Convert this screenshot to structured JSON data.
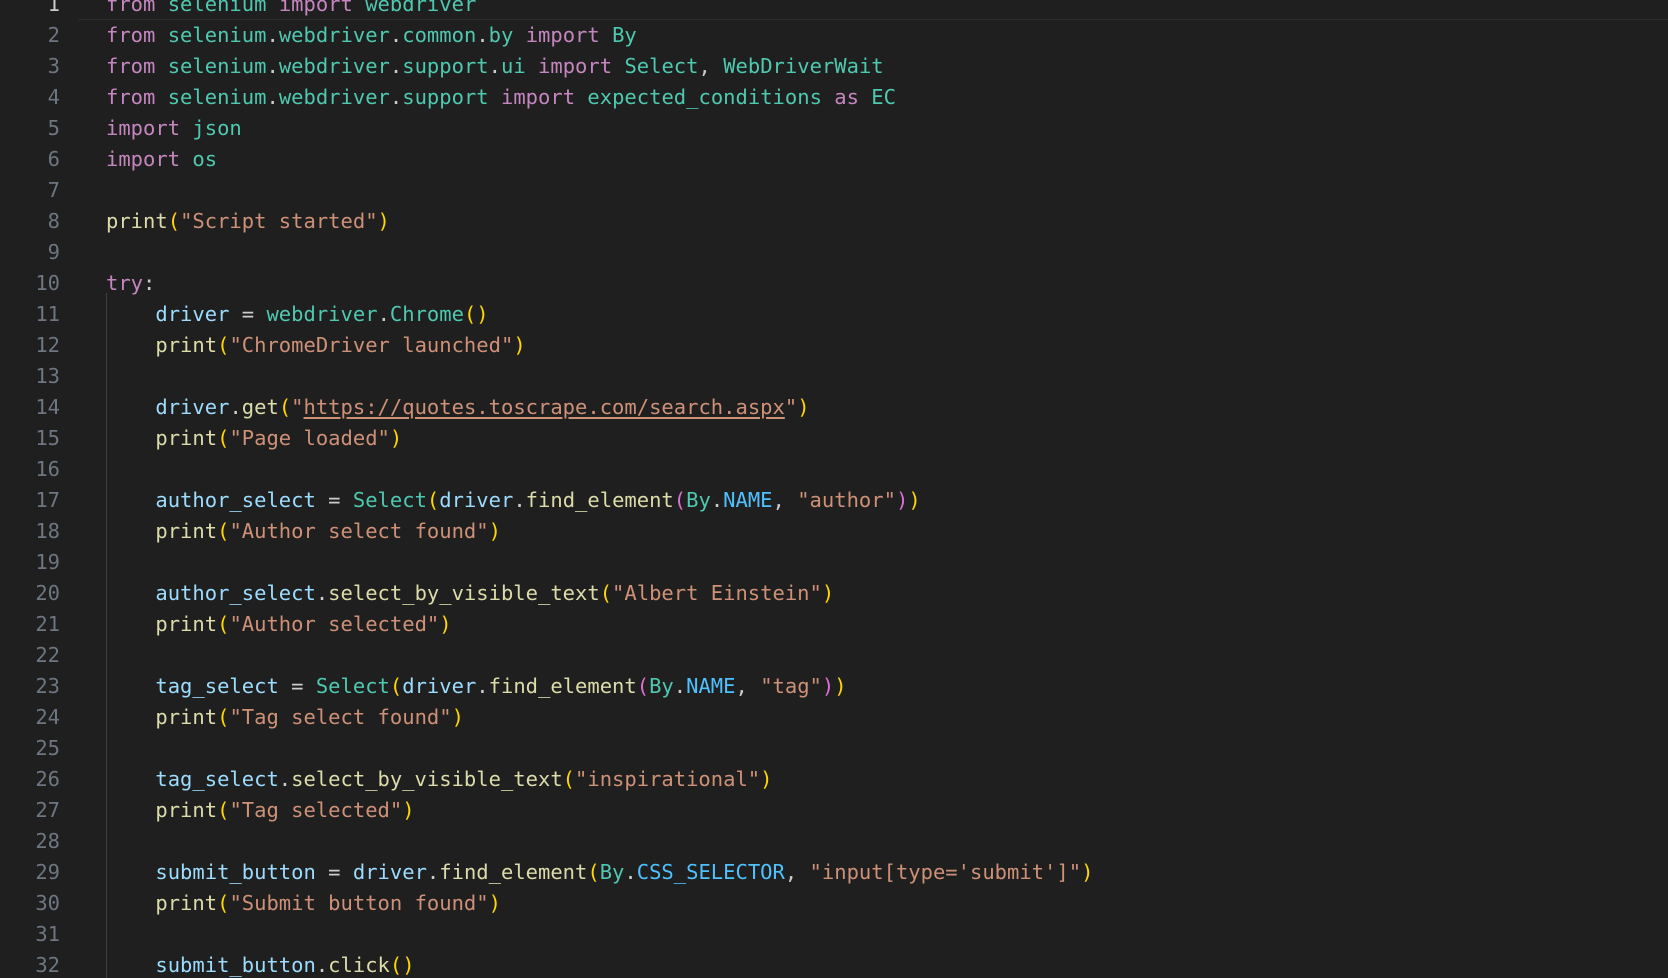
{
  "editor": {
    "language": "python",
    "active_line": 1,
    "colors": {
      "background": "#1f1f1f",
      "line_number": "#6e7681",
      "keyword": "#c586c0",
      "module_class": "#4ec9b0",
      "function": "#dcdcaa",
      "variable": "#9cdcfe",
      "constant": "#4fc1ff",
      "string": "#ce9178",
      "bracket_level_1": "#ffd700",
      "bracket_level_2": "#da70d6"
    },
    "lines": [
      {
        "n": "1",
        "tokens": [
          [
            "kw",
            "from"
          ],
          [
            "plain",
            " "
          ],
          [
            "mod",
            "selenium"
          ],
          [
            "plain",
            " "
          ],
          [
            "kw",
            "import"
          ],
          [
            "plain",
            " "
          ],
          [
            "mod",
            "webdriver"
          ]
        ]
      },
      {
        "n": "2",
        "tokens": [
          [
            "kw",
            "from"
          ],
          [
            "plain",
            " "
          ],
          [
            "mod",
            "selenium"
          ],
          [
            "plain",
            "."
          ],
          [
            "mod",
            "webdriver"
          ],
          [
            "plain",
            "."
          ],
          [
            "mod",
            "common"
          ],
          [
            "plain",
            "."
          ],
          [
            "mod",
            "by"
          ],
          [
            "plain",
            " "
          ],
          [
            "kw",
            "import"
          ],
          [
            "plain",
            " "
          ],
          [
            "cls",
            "By"
          ]
        ]
      },
      {
        "n": "3",
        "tokens": [
          [
            "kw",
            "from"
          ],
          [
            "plain",
            " "
          ],
          [
            "mod",
            "selenium"
          ],
          [
            "plain",
            "."
          ],
          [
            "mod",
            "webdriver"
          ],
          [
            "plain",
            "."
          ],
          [
            "mod",
            "support"
          ],
          [
            "plain",
            "."
          ],
          [
            "mod",
            "ui"
          ],
          [
            "plain",
            " "
          ],
          [
            "kw",
            "import"
          ],
          [
            "plain",
            " "
          ],
          [
            "cls",
            "Select"
          ],
          [
            "plain",
            ", "
          ],
          [
            "cls",
            "WebDriverWait"
          ]
        ]
      },
      {
        "n": "4",
        "tokens": [
          [
            "kw",
            "from"
          ],
          [
            "plain",
            " "
          ],
          [
            "mod",
            "selenium"
          ],
          [
            "plain",
            "."
          ],
          [
            "mod",
            "webdriver"
          ],
          [
            "plain",
            "."
          ],
          [
            "mod",
            "support"
          ],
          [
            "plain",
            " "
          ],
          [
            "kw",
            "import"
          ],
          [
            "plain",
            " "
          ],
          [
            "mod",
            "expected_conditions"
          ],
          [
            "plain",
            " "
          ],
          [
            "kw",
            "as"
          ],
          [
            "plain",
            " "
          ],
          [
            "mod",
            "EC"
          ]
        ]
      },
      {
        "n": "5",
        "tokens": [
          [
            "kw",
            "import"
          ],
          [
            "plain",
            " "
          ],
          [
            "mod",
            "json"
          ]
        ]
      },
      {
        "n": "6",
        "tokens": [
          [
            "kw",
            "import"
          ],
          [
            "plain",
            " "
          ],
          [
            "mod",
            "os"
          ]
        ]
      },
      {
        "n": "7",
        "tokens": []
      },
      {
        "n": "8",
        "tokens": [
          [
            "fn",
            "print"
          ],
          [
            "p1",
            "("
          ],
          [
            "str",
            "\"Script started\""
          ],
          [
            "p1",
            ")"
          ]
        ]
      },
      {
        "n": "9",
        "tokens": []
      },
      {
        "n": "10",
        "tokens": [
          [
            "kw",
            "try"
          ],
          [
            "plain",
            ":"
          ]
        ]
      },
      {
        "n": "11",
        "tokens": [
          [
            "plain",
            "    "
          ],
          [
            "var",
            "driver"
          ],
          [
            "plain",
            " = "
          ],
          [
            "mod",
            "webdriver"
          ],
          [
            "plain",
            "."
          ],
          [
            "cls",
            "Chrome"
          ],
          [
            "p1",
            "()"
          ]
        ]
      },
      {
        "n": "12",
        "tokens": [
          [
            "plain",
            "    "
          ],
          [
            "fn",
            "print"
          ],
          [
            "p1",
            "("
          ],
          [
            "str",
            "\"ChromeDriver launched\""
          ],
          [
            "p1",
            ")"
          ]
        ]
      },
      {
        "n": "13",
        "tokens": []
      },
      {
        "n": "14",
        "tokens": [
          [
            "plain",
            "    "
          ],
          [
            "var",
            "driver"
          ],
          [
            "plain",
            "."
          ],
          [
            "fn",
            "get"
          ],
          [
            "p1",
            "("
          ],
          [
            "str",
            "\""
          ],
          [
            "str url",
            "https://quotes.toscrape.com/search.aspx"
          ],
          [
            "str",
            "\""
          ],
          [
            "p1",
            ")"
          ]
        ]
      },
      {
        "n": "15",
        "tokens": [
          [
            "plain",
            "    "
          ],
          [
            "fn",
            "print"
          ],
          [
            "p1",
            "("
          ],
          [
            "str",
            "\"Page loaded\""
          ],
          [
            "p1",
            ")"
          ]
        ]
      },
      {
        "n": "16",
        "tokens": []
      },
      {
        "n": "17",
        "tokens": [
          [
            "plain",
            "    "
          ],
          [
            "var",
            "author_select"
          ],
          [
            "plain",
            " = "
          ],
          [
            "cls",
            "Select"
          ],
          [
            "p1",
            "("
          ],
          [
            "var",
            "driver"
          ],
          [
            "plain",
            "."
          ],
          [
            "fn",
            "find_element"
          ],
          [
            "p2",
            "("
          ],
          [
            "cls",
            "By"
          ],
          [
            "plain",
            "."
          ],
          [
            "const",
            "NAME"
          ],
          [
            "plain",
            ", "
          ],
          [
            "str",
            "\"author\""
          ],
          [
            "p2",
            ")"
          ],
          [
            "p1",
            ")"
          ]
        ]
      },
      {
        "n": "18",
        "tokens": [
          [
            "plain",
            "    "
          ],
          [
            "fn",
            "print"
          ],
          [
            "p1",
            "("
          ],
          [
            "str",
            "\"Author select found\""
          ],
          [
            "p1",
            ")"
          ]
        ]
      },
      {
        "n": "19",
        "tokens": []
      },
      {
        "n": "20",
        "tokens": [
          [
            "plain",
            "    "
          ],
          [
            "var",
            "author_select"
          ],
          [
            "plain",
            "."
          ],
          [
            "fn",
            "select_by_visible_text"
          ],
          [
            "p1",
            "("
          ],
          [
            "str",
            "\"Albert Einstein\""
          ],
          [
            "p1",
            ")"
          ]
        ]
      },
      {
        "n": "21",
        "tokens": [
          [
            "plain",
            "    "
          ],
          [
            "fn",
            "print"
          ],
          [
            "p1",
            "("
          ],
          [
            "str",
            "\"Author selected\""
          ],
          [
            "p1",
            ")"
          ]
        ]
      },
      {
        "n": "22",
        "tokens": []
      },
      {
        "n": "23",
        "tokens": [
          [
            "plain",
            "    "
          ],
          [
            "var",
            "tag_select"
          ],
          [
            "plain",
            " = "
          ],
          [
            "cls",
            "Select"
          ],
          [
            "p1",
            "("
          ],
          [
            "var",
            "driver"
          ],
          [
            "plain",
            "."
          ],
          [
            "fn",
            "find_element"
          ],
          [
            "p2",
            "("
          ],
          [
            "cls",
            "By"
          ],
          [
            "plain",
            "."
          ],
          [
            "const",
            "NAME"
          ],
          [
            "plain",
            ", "
          ],
          [
            "str",
            "\"tag\""
          ],
          [
            "p2",
            ")"
          ],
          [
            "p1",
            ")"
          ]
        ]
      },
      {
        "n": "24",
        "tokens": [
          [
            "plain",
            "    "
          ],
          [
            "fn",
            "print"
          ],
          [
            "p1",
            "("
          ],
          [
            "str",
            "\"Tag select found\""
          ],
          [
            "p1",
            ")"
          ]
        ]
      },
      {
        "n": "25",
        "tokens": []
      },
      {
        "n": "26",
        "tokens": [
          [
            "plain",
            "    "
          ],
          [
            "var",
            "tag_select"
          ],
          [
            "plain",
            "."
          ],
          [
            "fn",
            "select_by_visible_text"
          ],
          [
            "p1",
            "("
          ],
          [
            "str",
            "\"inspirational\""
          ],
          [
            "p1",
            ")"
          ]
        ]
      },
      {
        "n": "27",
        "tokens": [
          [
            "plain",
            "    "
          ],
          [
            "fn",
            "print"
          ],
          [
            "p1",
            "("
          ],
          [
            "str",
            "\"Tag selected\""
          ],
          [
            "p1",
            ")"
          ]
        ]
      },
      {
        "n": "28",
        "tokens": []
      },
      {
        "n": "29",
        "tokens": [
          [
            "plain",
            "    "
          ],
          [
            "var",
            "submit_button"
          ],
          [
            "plain",
            " = "
          ],
          [
            "var",
            "driver"
          ],
          [
            "plain",
            "."
          ],
          [
            "fn",
            "find_element"
          ],
          [
            "p1",
            "("
          ],
          [
            "cls",
            "By"
          ],
          [
            "plain",
            "."
          ],
          [
            "const",
            "CSS_SELECTOR"
          ],
          [
            "plain",
            ", "
          ],
          [
            "str",
            "\"input[type='submit']\""
          ],
          [
            "p1",
            ")"
          ]
        ]
      },
      {
        "n": "30",
        "tokens": [
          [
            "plain",
            "    "
          ],
          [
            "fn",
            "print"
          ],
          [
            "p1",
            "("
          ],
          [
            "str",
            "\"Submit button found\""
          ],
          [
            "p1",
            ")"
          ]
        ]
      },
      {
        "n": "31",
        "tokens": []
      },
      {
        "n": "32",
        "tokens": [
          [
            "plain",
            "    "
          ],
          [
            "var",
            "submit_button"
          ],
          [
            "plain",
            "."
          ],
          [
            "fn",
            "click"
          ],
          [
            "p1",
            "()"
          ]
        ]
      }
    ]
  }
}
